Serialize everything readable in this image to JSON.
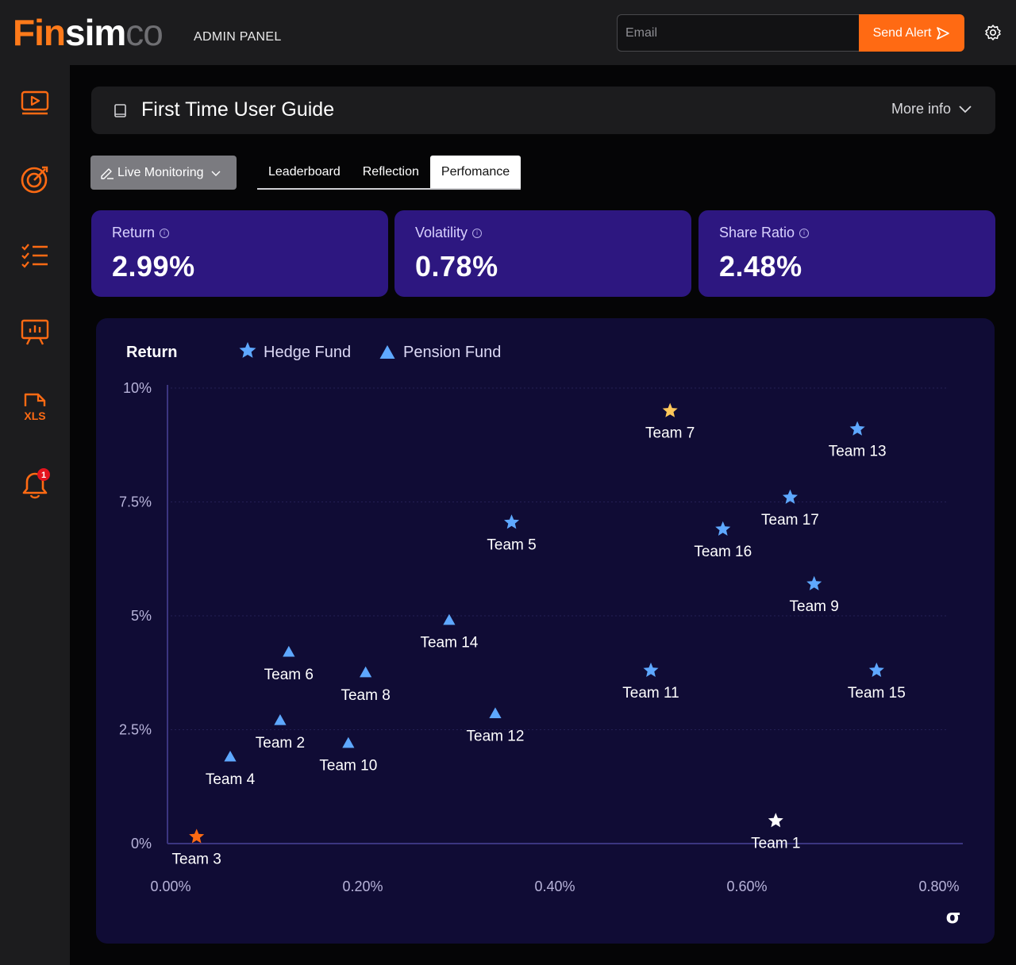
{
  "header": {
    "logo_fin": "Fin",
    "logo_sim": "sim",
    "logo_co": "co",
    "admin_label": "ADMIN PANEL",
    "email_placeholder": "Email",
    "send_label": "Send Alert"
  },
  "sidebar": {
    "items": [
      {
        "icon": "video-icon"
      },
      {
        "icon": "target-icon"
      },
      {
        "icon": "checklist-icon"
      },
      {
        "icon": "presentation-chart-icon"
      },
      {
        "icon": "xls-file-icon"
      },
      {
        "icon": "bell-icon",
        "badge": "1"
      }
    ]
  },
  "guide": {
    "title": "First Time User Guide",
    "more_info": "More info"
  },
  "controls": {
    "live_monitoring": "Live Monitoring",
    "tabs": [
      "Leaderboard",
      "Reflection",
      "Perfomance"
    ],
    "active_tab": "Perfomance"
  },
  "stats": [
    {
      "label": "Return",
      "value": "2.99%"
    },
    {
      "label": "Volatility",
      "value": "0.78%"
    },
    {
      "label": "Share Ratio",
      "value": "2.48%"
    }
  ],
  "colors": {
    "accent": "#ff6a13",
    "card": "#2d1780",
    "chart_bg": "#100c35",
    "hedge": "#5ea8ff",
    "pension": "#5ea8ff",
    "highlight_gold": "#ffc85a",
    "highlight_orange": "#ff6a13",
    "highlight_white": "#ffffff"
  },
  "chart_data": {
    "type": "scatter",
    "ylabel": "Return",
    "xlabel": "σ",
    "x_ticks": [
      "0.00%",
      "0.20%",
      "0.40%",
      "0.60%",
      "0.80%"
    ],
    "y_ticks": [
      "0%",
      "2.5%",
      "5%",
      "7.5%",
      "10%"
    ],
    "xlim": [
      0,
      0.8
    ],
    "ylim": [
      0,
      10
    ],
    "grid": true,
    "legend_position": "top",
    "series": [
      {
        "name": "Hedge Fund",
        "marker": "star",
        "points": [
          {
            "label": "Team 7",
            "x": 0.52,
            "y": 9.5,
            "color": "#ffc85a"
          },
          {
            "label": "Team 13",
            "x": 0.715,
            "y": 9.1
          },
          {
            "label": "Team 17",
            "x": 0.645,
            "y": 7.6
          },
          {
            "label": "Team 16",
            "x": 0.575,
            "y": 6.9
          },
          {
            "label": "Team 5",
            "x": 0.355,
            "y": 7.05
          },
          {
            "label": "Team 9",
            "x": 0.67,
            "y": 5.7
          },
          {
            "label": "Team 11",
            "x": 0.5,
            "y": 3.8
          },
          {
            "label": "Team 15",
            "x": 0.735,
            "y": 3.8
          },
          {
            "label": "Team 1",
            "x": 0.63,
            "y": 0.5,
            "color": "#ffffff"
          },
          {
            "label": "Team 3",
            "x": 0.027,
            "y": 0.15,
            "color": "#ff6a13"
          }
        ]
      },
      {
        "name": "Pension Fund",
        "marker": "triangle",
        "points": [
          {
            "label": "Team 14",
            "x": 0.29,
            "y": 4.9
          },
          {
            "label": "Team 6",
            "x": 0.123,
            "y": 4.2
          },
          {
            "label": "Team 8",
            "x": 0.203,
            "y": 3.75
          },
          {
            "label": "Team 12",
            "x": 0.338,
            "y": 2.85
          },
          {
            "label": "Team 2",
            "x": 0.114,
            "y": 2.7
          },
          {
            "label": "Team 10",
            "x": 0.185,
            "y": 2.2
          },
          {
            "label": "Team 4",
            "x": 0.062,
            "y": 1.9
          }
        ]
      }
    ]
  }
}
